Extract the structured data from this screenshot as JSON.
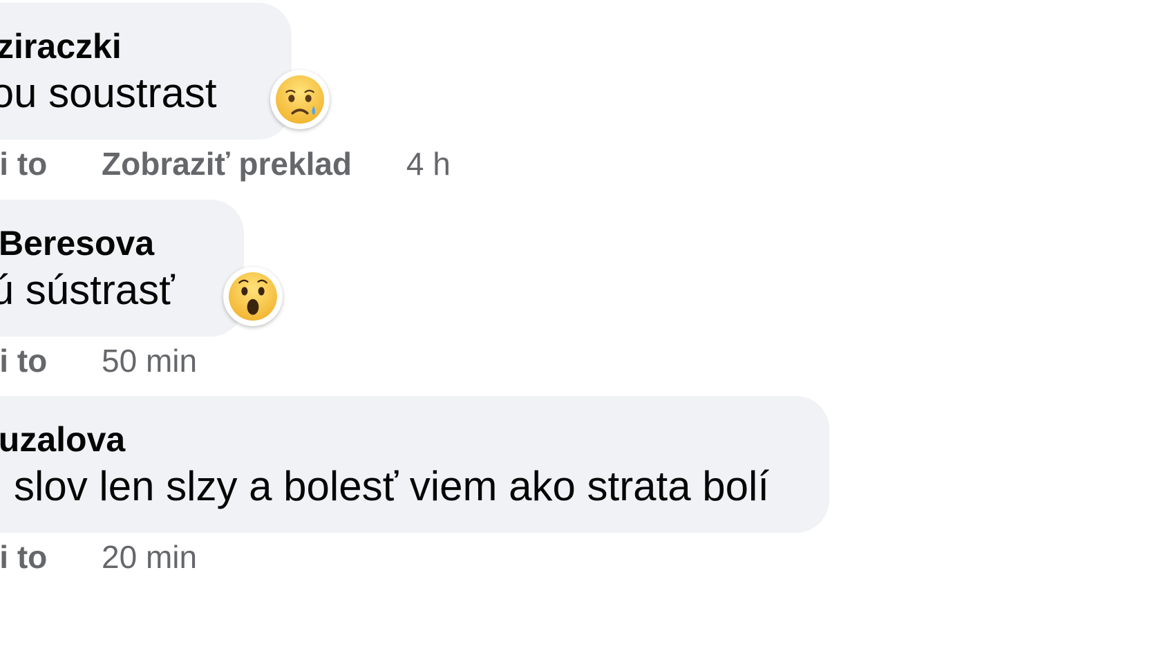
{
  "comments": [
    {
      "author": "a Sziraczki",
      "text": "nnou soustrast",
      "like_label": "a mi to",
      "translate_label": "Zobraziť preklad",
      "time": "4 h",
      "reaction": "sad-icon"
    },
    {
      "author": "Beresova",
      "text": "nnú sústrasť",
      "like_label": "a mi to",
      "time": "50 min",
      "reaction": "wow-icon"
    },
    {
      "author": "a Buzalova",
      "text": "am slov len slzy a bolesť viem ako strata bolí",
      "like_label": "a mi to",
      "time": "20 min"
    }
  ],
  "colors": {
    "bubble": "#f0f2f5",
    "text": "#050505",
    "meta": "#65676b",
    "emoji_yellow": "#f7c843",
    "tear_blue": "#4aa8f0"
  }
}
